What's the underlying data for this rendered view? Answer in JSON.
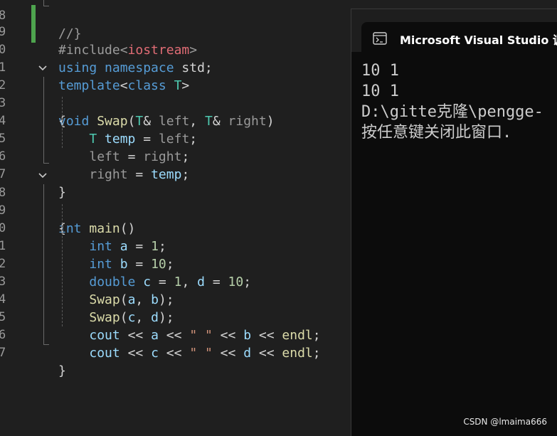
{
  "editor": {
    "line_numbers": [
      "8",
      "9",
      "0",
      "1",
      "2",
      "3",
      "4",
      "5",
      "6",
      "7",
      "8",
      "9",
      "0",
      "1",
      "2",
      "3",
      "4",
      "5",
      "6",
      "7"
    ],
    "top_fragment": "//}"
  },
  "console": {
    "title": "Microsoft Visual Studio 调试",
    "output_lines": [
      "10 1",
      "10 1",
      "",
      "D:\\gitte克隆\\pengge-",
      "按任意键关闭此窗口. "
    ]
  },
  "watermark": "CSDN @lmaima666",
  "colors": {
    "keyword": "#569cd6",
    "type": "#4ec9b0",
    "function": "#dcdcaa",
    "variable": "#9cdcfe",
    "number": "#b5cea8",
    "string": "#ce9178",
    "change_bar": "#4ea44e"
  }
}
